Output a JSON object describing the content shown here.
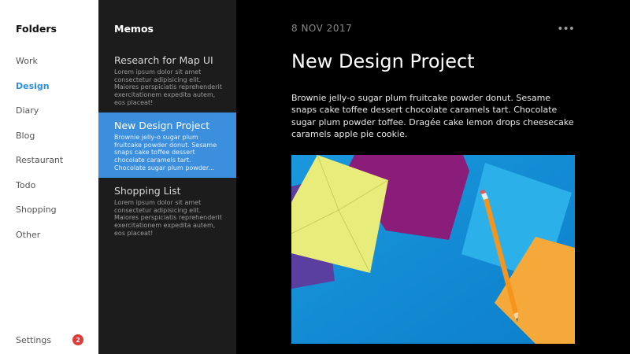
{
  "folders": {
    "title": "Folders",
    "items": [
      {
        "label": "Work",
        "active": false
      },
      {
        "label": "Design",
        "active": true
      },
      {
        "label": "Diary",
        "active": false
      },
      {
        "label": "Blog",
        "active": false
      },
      {
        "label": "Restaurant",
        "active": false
      },
      {
        "label": "Todo",
        "active": false
      },
      {
        "label": "Shopping",
        "active": false
      },
      {
        "label": "Other",
        "active": false
      }
    ],
    "settings_label": "Settings",
    "settings_badge": "2"
  },
  "memos": {
    "title": "Memos",
    "items": [
      {
        "title": "Research for Map UI",
        "preview": "Lorem ipsum dolor sit amet consectetur adipisicing elit. Maiores perspiciatis reprehenderit exercitationem expedita autem, eos placeat!",
        "active": false
      },
      {
        "title": "New Design Project",
        "preview": "Brownie jelly-o sugar plum fruitcake powder donut. Sesame snaps cake toffee dessert chocolate caramels tart. Chocolate sugar plum powder...",
        "active": true
      },
      {
        "title": "Shopping List",
        "preview": "Lorem ipsum dolor sit amet consectetur adipisicing elit. Maiores perspiciatis reprehenderit exercitationem expedita autem, eos placeat!",
        "active": false
      }
    ]
  },
  "document": {
    "date": "8 NOV 2017",
    "more_label": "•••",
    "title": "New Design Project",
    "body": "Brownie jelly-o sugar plum fruitcake powder donut. Sesame snaps cake toffee dessert chocolate caramels tart. Chocolate sugar plum powder toffee. Dragée cake lemon drops cheesecake caramels apple pie cookie.",
    "image_icon": "envelopes-and-pencil-photo"
  },
  "colors": {
    "accent": "#3b8fdc",
    "active_folder": "#2f8fd8",
    "badge": "#e03a3a",
    "memos_bg": "#1c1c1c",
    "content_bg": "#000000"
  }
}
